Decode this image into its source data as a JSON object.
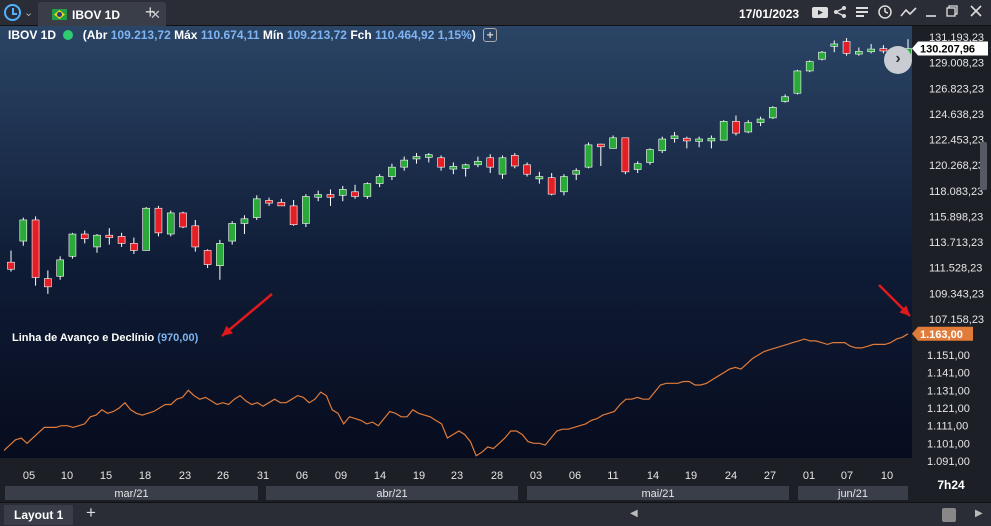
{
  "topbar": {
    "tab_label": "IBOV 1D",
    "tab_close": "✕",
    "new_tab": "+",
    "date": "17/01/2023",
    "dropdown": "⌄"
  },
  "info": {
    "symbol": "IBOV 1D",
    "open_label": "(Abr",
    "open": "109.213,72",
    "high_label": "Máx",
    "high": "110.674,11",
    "low_label": "Mín",
    "low": "109.213,72",
    "close_label": "Fch",
    "close": "110.464,92",
    "change": "1,15%",
    "close_paren": ")",
    "add": "+"
  },
  "indicator": {
    "name": "Linha de Avanço e Declínio",
    "value": "(970,00)"
  },
  "price_axis": {
    "labels": [
      "131.193,23",
      "129.008,23",
      "126.823,23",
      "124.638,23",
      "122.453,23",
      "120.268,23",
      "118.083,23",
      "115.898,23",
      "113.713,23",
      "111.528,23",
      "109.343,23",
      "107.158,23"
    ],
    "current": "130.207,96",
    "current_color": "#ffffff"
  },
  "indicator_axis": {
    "labels": [
      "1.151,00",
      "1.141,00",
      "1.131,00",
      "1.121,00",
      "1.111,00",
      "1.101,00",
      "1.091,00"
    ],
    "current": "1.163,00",
    "current_color": "#e07b39"
  },
  "time_axis": {
    "days": [
      "05",
      "10",
      "15",
      "18",
      "23",
      "26",
      "31",
      "06",
      "09",
      "14",
      "19",
      "23",
      "28",
      "03",
      "06",
      "11",
      "14",
      "19",
      "24",
      "27",
      "01",
      "07",
      "10"
    ],
    "months": [
      "mar/21",
      "abr/21",
      "mai/21",
      "jun/21"
    ],
    "time": "7h24"
  },
  "colors": {
    "up": "#2aa838",
    "down": "#e31e24",
    "line": "#e07b39",
    "arrow": "#e0191c"
  },
  "bottombar": {
    "layout_tab": "Layout 1",
    "add": "+"
  },
  "chart_data": [
    {
      "type": "candlestick",
      "series_name": "IBOV 1D",
      "ylim": [
        106500,
        131500
      ],
      "candles": [
        [
          112000,
          113000,
          111200,
          111400
        ],
        [
          113800,
          115800,
          113400,
          115600
        ],
        [
          115600,
          115900,
          110000,
          110700
        ],
        [
          110600,
          111300,
          109300,
          109900
        ],
        [
          110800,
          112500,
          110500,
          112200
        ],
        [
          112500,
          114500,
          112300,
          114400
        ],
        [
          114400,
          114700,
          113600,
          114000
        ],
        [
          113300,
          114400,
          112800,
          114300
        ],
        [
          114300,
          114900,
          113500,
          114100
        ],
        [
          114200,
          114500,
          113300,
          113600
        ],
        [
          113600,
          114100,
          112700,
          113000
        ],
        [
          113000,
          116700,
          113000,
          116600
        ],
        [
          116600,
          116800,
          114200,
          114500
        ],
        [
          114400,
          116400,
          114200,
          116200
        ],
        [
          116200,
          116300,
          114900,
          115000
        ],
        [
          115100,
          115600,
          112900,
          113300
        ],
        [
          113000,
          113100,
          111500,
          111800
        ],
        [
          111700,
          113900,
          110500,
          113600
        ],
        [
          113800,
          115500,
          113500,
          115300
        ],
        [
          115300,
          116000,
          114400,
          115700
        ],
        [
          115800,
          117700,
          115600,
          117400
        ],
        [
          117200,
          117500,
          116800,
          117100
        ],
        [
          117100,
          117400,
          116800,
          116800
        ],
        [
          116800,
          117300,
          115100,
          115200
        ],
        [
          115300,
          117800,
          115000,
          117600
        ],
        [
          117600,
          118100,
          117200,
          117700
        ],
        [
          117700,
          118200,
          116800,
          117600
        ],
        [
          117700,
          118500,
          117200,
          118200
        ],
        [
          118000,
          118600,
          117400,
          117600
        ],
        [
          117600,
          118800,
          117400,
          118700
        ],
        [
          118700,
          119500,
          118400,
          119300
        ],
        [
          119300,
          120400,
          119000,
          120100
        ],
        [
          120100,
          121000,
          119800,
          120700
        ],
        [
          120800,
          121300,
          120400,
          121000
        ],
        [
          121000,
          121300,
          120500,
          121100
        ],
        [
          120900,
          121100,
          119800,
          120100
        ],
        [
          120000,
          120500,
          119500,
          120100
        ],
        [
          120000,
          120400,
          119300,
          120300
        ],
        [
          120300,
          121000,
          120100,
          120600
        ],
        [
          120900,
          121200,
          119600,
          120100
        ],
        [
          119500,
          121100,
          119100,
          120900
        ],
        [
          121100,
          121300,
          120000,
          120200
        ],
        [
          120300,
          120500,
          119300,
          119500
        ],
        [
          119100,
          119700,
          118700,
          119300
        ],
        [
          119200,
          119600,
          117700,
          117800
        ],
        [
          118000,
          119500,
          117700,
          119300
        ],
        [
          119500,
          120000,
          119000,
          119800
        ],
        [
          120100,
          122200,
          120000,
          122000
        ],
        [
          122000,
          122100,
          120200,
          121900
        ],
        [
          121700,
          122800,
          121700,
          122600
        ],
        [
          122600,
          122600,
          119500,
          119700
        ],
        [
          119900,
          120600,
          119600,
          120400
        ],
        [
          120500,
          121700,
          120300,
          121600
        ],
        [
          121500,
          122700,
          121300,
          122500
        ],
        [
          122600,
          123100,
          122200,
          122700
        ],
        [
          122500,
          122700,
          121700,
          122400
        ],
        [
          122300,
          122700,
          121800,
          122500
        ],
        [
          122400,
          122800,
          121700,
          122500
        ],
        [
          122400,
          124100,
          122400,
          124000
        ],
        [
          124000,
          124500,
          122800,
          123000
        ],
        [
          123100,
          124100,
          123000,
          123900
        ],
        [
          123900,
          124400,
          123600,
          124200
        ],
        [
          124300,
          125300,
          124200,
          125200
        ],
        [
          125700,
          126300,
          125600,
          126100
        ],
        [
          126400,
          128400,
          126300,
          128300
        ],
        [
          128300,
          129200,
          128200,
          129100
        ],
        [
          129300,
          130000,
          129200,
          129900
        ],
        [
          130400,
          130900,
          129900,
          130600
        ],
        [
          130800,
          131100,
          129600,
          129800
        ],
        [
          129800,
          130300,
          129600,
          129900
        ],
        [
          130000,
          130600,
          129800,
          130100
        ],
        [
          130200,
          130500,
          129800,
          130000
        ],
        [
          130000,
          130300,
          129300,
          129500
        ],
        [
          129500,
          131000,
          129300,
          130207.96
        ]
      ]
    },
    {
      "type": "line",
      "series_name": "Linha de Avanço e Declínio",
      "ylim": [
        1089,
        1170
      ],
      "values": [
        1097,
        1100,
        1103,
        1104,
        1101,
        1104,
        1107,
        1110,
        1110,
        1110,
        1111,
        1111,
        1110,
        1111,
        1112,
        1116,
        1117,
        1120,
        1118,
        1119,
        1121,
        1124,
        1120,
        1118,
        1117,
        1118,
        1119,
        1121,
        1123,
        1123,
        1126,
        1127,
        1131,
        1128,
        1126,
        1127,
        1125,
        1123,
        1124,
        1123,
        1126,
        1128,
        1125,
        1123,
        1124,
        1122,
        1124,
        1126,
        1124,
        1124,
        1126,
        1128,
        1127,
        1124,
        1126,
        1130,
        1128,
        1120,
        1118,
        1112,
        1116,
        1115,
        1114,
        1112,
        1113,
        1111,
        1115,
        1119,
        1118,
        1116,
        1116,
        1120,
        1118,
        1117,
        1116,
        1114,
        1112,
        1104,
        1106,
        1108,
        1106,
        1102,
        1094,
        1096,
        1099,
        1098,
        1101,
        1104,
        1108,
        1108,
        1106,
        1102,
        1101,
        1101,
        1100,
        1104,
        1108,
        1109,
        1109,
        1110,
        1111,
        1112,
        1114,
        1115,
        1117,
        1118,
        1119,
        1123,
        1126,
        1126,
        1127,
        1126,
        1126,
        1130,
        1134,
        1135,
        1135,
        1135,
        1136,
        1136,
        1134,
        1134,
        1135,
        1137,
        1139,
        1141,
        1143,
        1144,
        1143,
        1146,
        1149,
        1151,
        1153,
        1154,
        1155,
        1156,
        1157,
        1158,
        1159,
        1160,
        1159,
        1159,
        1158,
        1157,
        1158,
        1158,
        1158,
        1156,
        1155,
        1155,
        1156,
        1157,
        1157,
        1157,
        1158,
        1160,
        1161,
        1163
      ]
    }
  ]
}
